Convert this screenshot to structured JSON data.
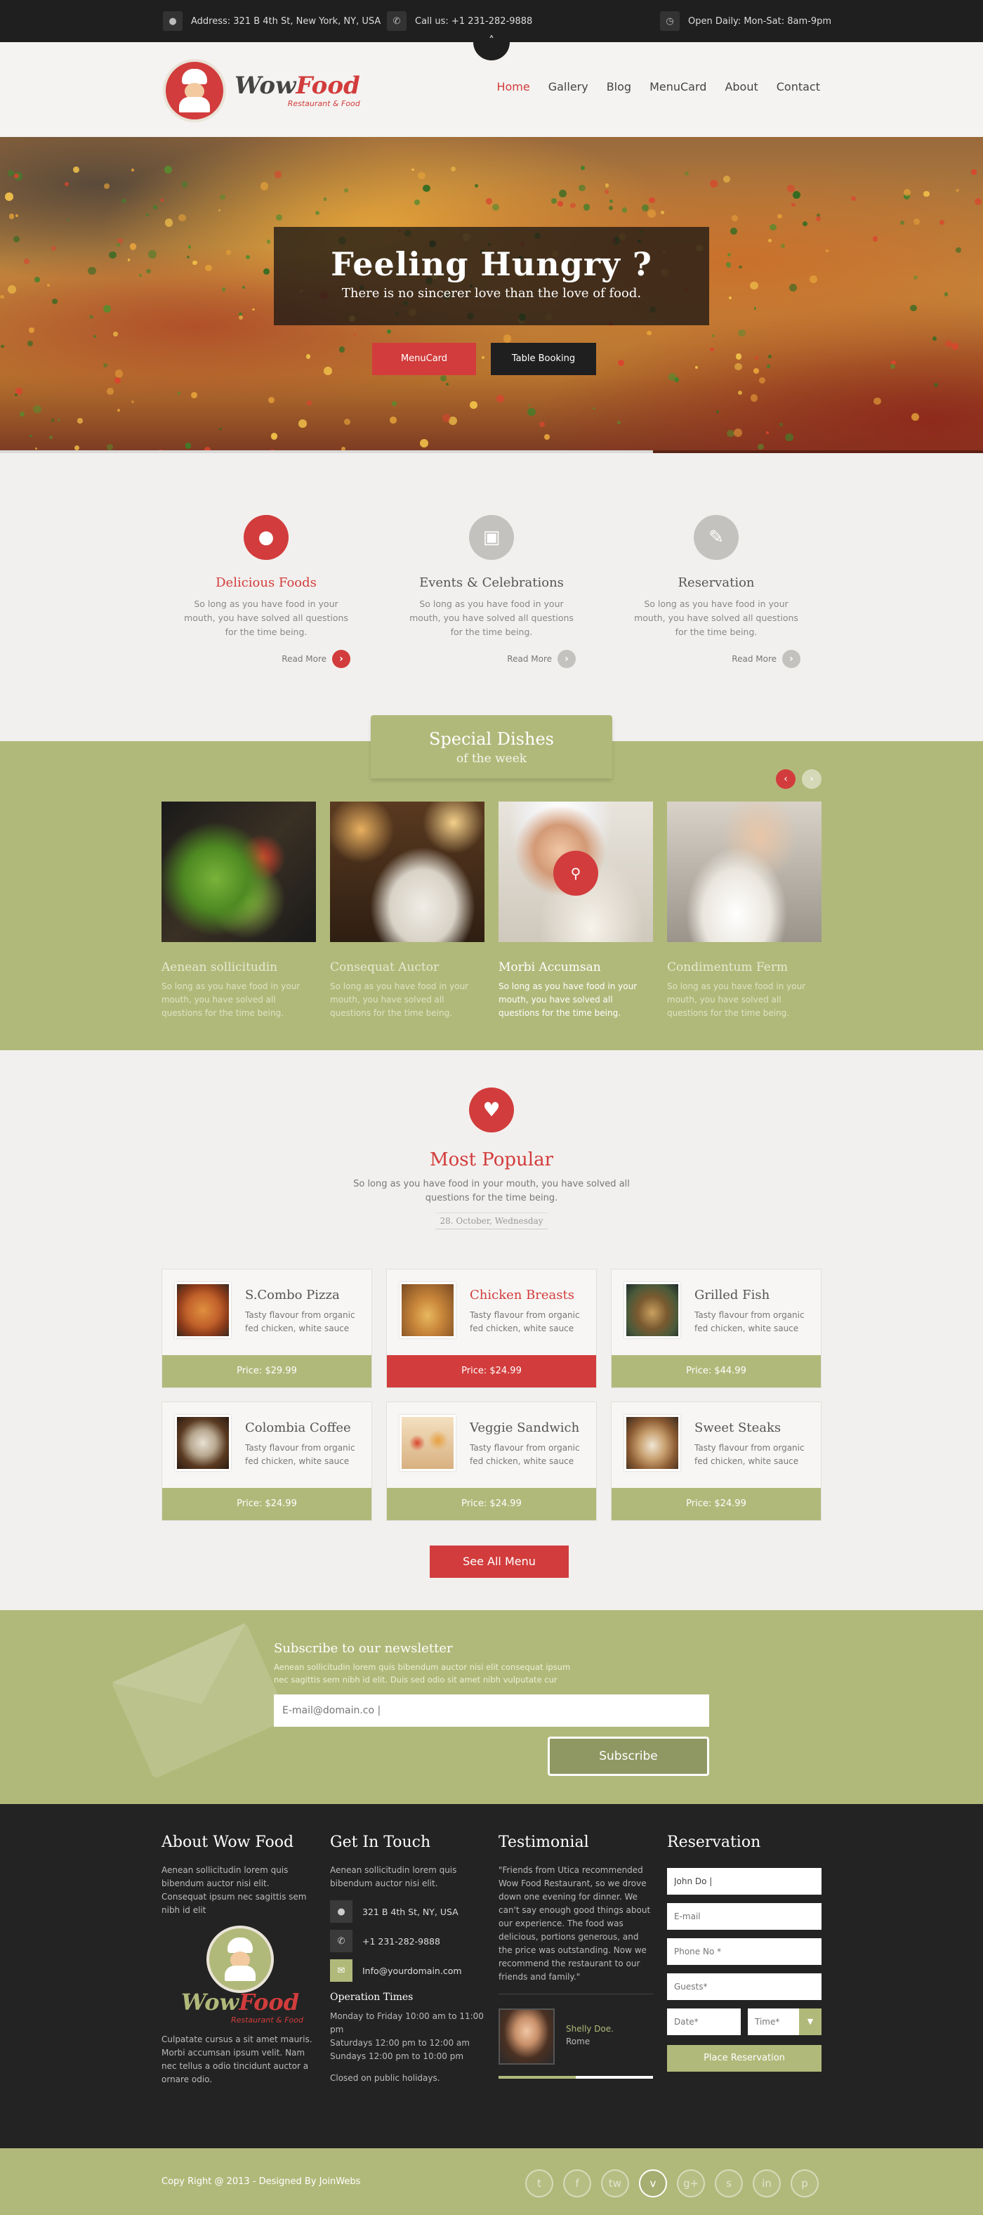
{
  "topbar": {
    "address": "Address:  321 B 4th St, New York, NY, USA",
    "phone": "Call us:  +1 231-282-9888",
    "hours": "Open Daily: Mon-Sat: 8am-9pm",
    "toggle_icon": "chevron-up-icon"
  },
  "logo": {
    "name_dark": "Wow",
    "name_red": "Food",
    "tagline": "Restaurant & Food"
  },
  "nav": [
    "Home",
    "Gallery",
    "Blog",
    "MenuCard",
    "About",
    "Contact"
  ],
  "hero": {
    "title": "Feeling Hungry ?",
    "subtitle": "There is no sincerer love than the love of food.",
    "btn_menu": "MenuCard",
    "btn_booking": "Table Booking"
  },
  "features": [
    {
      "title": "Delicious Foods",
      "text": "So long as you have food in your mouth, you have solved all questions for the time being.",
      "more": "Read More",
      "icon": "cloche-icon",
      "color": "#d23c3c"
    },
    {
      "title": "Events & Celebrations",
      "text": "So long as you have food in your mouth, you have solved all questions for the time being.",
      "more": "Read More",
      "icon": "cake-icon",
      "color": "#c4c2bf"
    },
    {
      "title": "Reservation",
      "text": "So long as you have food in your mouth, you have solved all questions for the time being.",
      "more": "Read More",
      "icon": "edit-icon",
      "color": "#c4c2bf"
    }
  ],
  "special": {
    "title": "Special Dishes",
    "subtitle": "of the week",
    "dishes": [
      {
        "title": "Aenean sollicitudin",
        "text": "So long as you have food in your mouth, you have solved all questions for the time being."
      },
      {
        "title": "Consequat Auctor",
        "text": "So long as you have food in your mouth, you have solved all questions for the time being."
      },
      {
        "title": "Morbi Accumsan",
        "text": "So long as you have food in your mouth, you have solved all questions for the time being."
      },
      {
        "title": "Condimentum Ferm",
        "text": "So long as you have food in your mouth, you have solved all questions for the time being."
      }
    ]
  },
  "popular": {
    "title": "Most Popular",
    "text": "So long as you have food in your mouth, you have solved all questions for the time being.",
    "date": "28. October, Wednesday",
    "items": [
      {
        "name": "S.Combo Pizza",
        "desc": "Tasty flavour from organic fed chicken, white sauce",
        "price": "Price:   $29.99"
      },
      {
        "name": "Chicken Breasts",
        "desc": "Tasty flavour from organic fed chicken, white sauce",
        "price": "Price:   $24.99"
      },
      {
        "name": "Grilled Fish",
        "desc": "Tasty flavour from organic fed chicken, white sauce",
        "price": "Price:   $44.99"
      },
      {
        "name": "Colombia Coffee",
        "desc": "Tasty flavour from organic fed chicken, white sauce",
        "price": "Price:   $24.99"
      },
      {
        "name": "Veggie Sandwich",
        "desc": "Tasty flavour from organic fed chicken, white sauce",
        "price": "Price:   $24.99"
      },
      {
        "name": "Sweet Steaks",
        "desc": "Tasty flavour from organic fed chicken, white sauce",
        "price": "Price:   $24.99"
      }
    ],
    "see_all": "See All Menu"
  },
  "newsletter": {
    "title": "Subscribe to our newsletter",
    "text": "Aenean sollicitudin lorem quis bibendum auctor nisi elit consequat ipsum nec sagittis sem nibh id elit. Duis sed odio sit amet nibh vulputate cur",
    "placeholder": "E-mail@domain.co |",
    "button": "Subscribe"
  },
  "footer": {
    "about": {
      "title": "About Wow Food",
      "text1": "Aenean sollicitudin lorem quis bibendum auctor nisi elit. Consequat ipsum nec sagittis sem nibh id elit",
      "text2": "Culpatate cursus a sit amet mauris. Morbi accumsan ipsum velit. Nam nec tellus a odio tincidunt auctor a ornare odio."
    },
    "contact": {
      "title": "Get In Touch",
      "text": "Aenean sollicitudin lorem quis bibendum auctor nisi elit.",
      "address": "321 B 4th St, NY, USA",
      "phone": "+1 231-282-9888",
      "email": "Info@yourdomain.com",
      "hours_title": "Operation Times",
      "hours": [
        "Monday to Friday 10:00 am to 11:00 pm",
        "Saturdays 12:00 pm to 12:00 am",
        "Sundays 12:00 pm to 10:00 pm"
      ],
      "closed": "Closed on public holidays."
    },
    "testimonial": {
      "title": "Testimonial",
      "quote": "\"Friends from Utica recommended Wow Food Restaurant, so we drove down one evening for dinner. We can't say enough good things about our experience. The food was delicious, portions generous, and the price was outstanding. Now we recommend the restaurant to our friends and family.\"",
      "name": "Shelly Doe.",
      "city": "Rome"
    },
    "reservation": {
      "title": "Reservation",
      "name_value": "John Do |",
      "email_ph": "E-mail",
      "phone_ph": "Phone No *",
      "guests_ph": "Guests*",
      "date_ph": "Date*",
      "time_ph": "Time*",
      "button": "Place Reservation"
    }
  },
  "copyright": "Copy Right @ 2013 - Designed By JoinWebs",
  "social": [
    "t",
    "f",
    "tw",
    "v",
    "g+",
    "s",
    "in",
    "p"
  ],
  "colors": {
    "accent": "#d23c3c",
    "olive": "#b1b97a",
    "dark": "#232323"
  }
}
